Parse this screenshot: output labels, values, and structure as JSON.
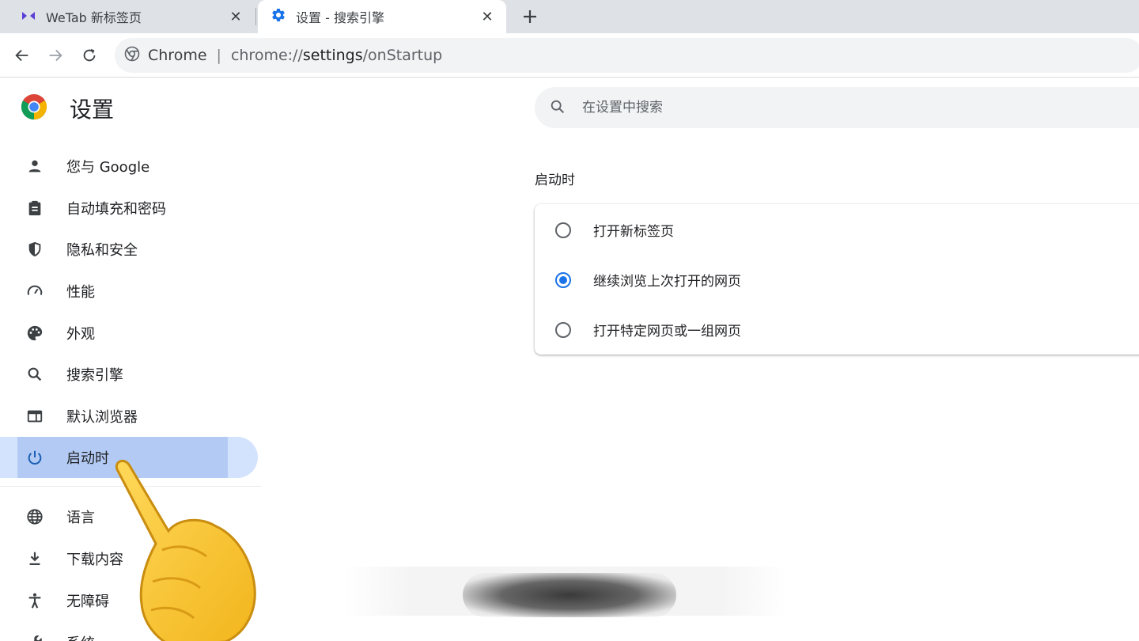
{
  "browser": {
    "tabs": [
      {
        "title": "WeTab 新标签页",
        "active": false
      },
      {
        "title": "设置 - 搜索引擎",
        "active": true
      }
    ],
    "omnibox": {
      "site_label": "Chrome",
      "url_prefix": "chrome://",
      "url_host": "settings",
      "url_path": "/onStartup"
    }
  },
  "sidebar": {
    "title": "设置",
    "items": [
      {
        "label": "您与 Google",
        "icon": "person-icon"
      },
      {
        "label": "自动填充和密码",
        "icon": "clipboard-icon"
      },
      {
        "label": "隐私和安全",
        "icon": "shield-icon"
      },
      {
        "label": "性能",
        "icon": "speedometer-icon"
      },
      {
        "label": "外观",
        "icon": "palette-icon"
      },
      {
        "label": "搜索引擎",
        "icon": "search-icon"
      },
      {
        "label": "默认浏览器",
        "icon": "browser-window-icon"
      },
      {
        "label": "启动时",
        "icon": "power-icon",
        "active": true
      },
      {
        "label": "语言",
        "icon": "globe-icon"
      },
      {
        "label": "下载内容",
        "icon": "download-icon"
      },
      {
        "label": "无障碍",
        "icon": "accessibility-icon"
      },
      {
        "label": "系统",
        "icon": "wrench-icon"
      }
    ]
  },
  "search": {
    "placeholder": "在设置中搜索"
  },
  "startup": {
    "section_title": "启动时",
    "options": [
      {
        "label": "打开新标签页",
        "checked": false
      },
      {
        "label": "继续浏览上次打开的网页",
        "checked": true
      },
      {
        "label": "打开特定网页或一组网页",
        "checked": false
      }
    ]
  },
  "colors": {
    "accent": "#1a73e8",
    "active_item_bg": "#d3e3fd",
    "tab_strip": "#dee1e6"
  }
}
